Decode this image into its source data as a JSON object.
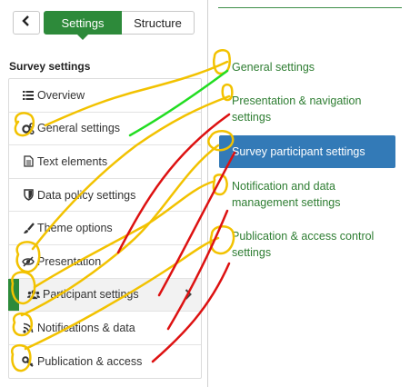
{
  "topbar": {
    "back_icon": "chevron-left-icon",
    "tabs": [
      {
        "label": "Settings",
        "active": true
      },
      {
        "label": "Structure",
        "active": false
      }
    ]
  },
  "sidebar": {
    "section_title": "Survey settings",
    "items": [
      {
        "label": "Overview",
        "icon": "list-icon"
      },
      {
        "label": "General settings",
        "icon": "gears-icon"
      },
      {
        "label": "Text elements",
        "icon": "file-text-icon"
      },
      {
        "label": "Data policy settings",
        "icon": "shield-icon"
      },
      {
        "label": "Theme options",
        "icon": "paintbrush-icon"
      },
      {
        "label": "Presentation",
        "icon": "eye-slash-icon"
      },
      {
        "label": "Participant settings",
        "icon": "users-icon",
        "active": true
      },
      {
        "label": "Notifications & data",
        "icon": "feed-icon"
      },
      {
        "label": "Publication & access",
        "icon": "key-icon"
      }
    ]
  },
  "right_pane": {
    "links": [
      {
        "label": "General settings"
      },
      {
        "label": "Presentation & navigation settings"
      },
      {
        "label": "Survey participant settings",
        "active": true
      },
      {
        "label": "Notification and data management settings"
      },
      {
        "label": "Publication & access control settings"
      }
    ]
  },
  "colors": {
    "accent_green": "#2d8a3a",
    "active_blue": "#337ab7",
    "link_green": "#2e7d32",
    "annotation_yellow": "#f2c200",
    "annotation_green": "#22dd22",
    "annotation_red": "#dd1111"
  }
}
